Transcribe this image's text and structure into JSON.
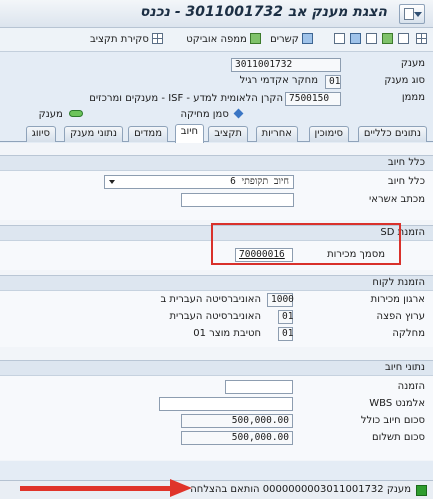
{
  "window": {
    "title": "הצגת מענק אב 3011001732 - נכנס"
  },
  "toolbar": {
    "items": [
      "סקירת תקציב",
      "ממפה אוביקט",
      "קשרים"
    ]
  },
  "header": {
    "grant_label": "מענק",
    "grant_value": "3011001732",
    "grant_type_label": "סוג מענק",
    "grant_type_value": "01",
    "grant_type_text": "מחקר אקדמי רגיל",
    "sponsor_label": "מממן",
    "sponsor_value": "7500150",
    "sponsor_text": "הקרן הלאומית למדע - ISF - מענקים ומרכזים",
    "block_flag_label": "סמן מחיקה",
    "grant_status_label": "מענק"
  },
  "tabs": [
    "נתונים כלליים",
    "סימוכין",
    "אחריות",
    "תקציב",
    "חיוב",
    "ממדים",
    "נתוני מענק",
    "סיווג"
  ],
  "active_tab": "חיוב",
  "billing_rule": {
    "title": "כלל חיוב",
    "rule_label": "כלל חיוב",
    "rule_value": "6 חיוב תקופתי",
    "letter_label": "מכתב אשראי"
  },
  "sd_order": {
    "title": "הזמנת SD",
    "doc_label": "מסמך מכירות",
    "doc_value": "70000016"
  },
  "customer_order": {
    "title": "הזמנת לקוח",
    "sales_org_label": "ארגון מכירות",
    "sales_org_value": "1000",
    "sales_org_text": "האוניברסיטה העברית ב",
    "channel_label": "ערוץ הפצה",
    "channel_value": "01",
    "channel_text": "האוניברסיטה העברית",
    "division_label": "מחלקה",
    "division_value": "01",
    "division_text": "חטיבת מוצר 01"
  },
  "billing_data": {
    "title": "נתוני חיוב",
    "order_label": "הזמנה",
    "wbs_label": "אלמנט WBS",
    "total_label": "סכום חיוב כולל",
    "total_value": "500,000.00",
    "payment_label": "סכום תשלום",
    "payment_value": "500,000.00"
  },
  "status": {
    "message": "מענק 0000000003011001732 הותאם בהצלחה"
  },
  "colors": {
    "highlight": "#d9312b",
    "arrow": "#e0342a",
    "success": "#2f9d2f"
  }
}
